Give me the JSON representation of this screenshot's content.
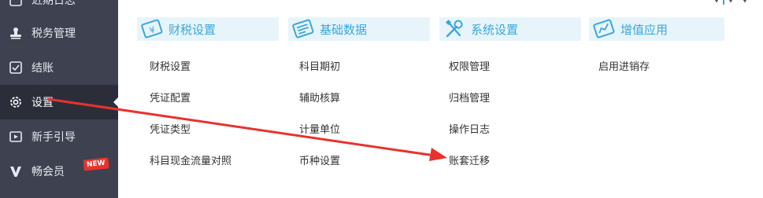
{
  "sidebar": {
    "items": [
      {
        "label": "近期日志",
        "icon": "calendar-icon"
      },
      {
        "label": "税务管理",
        "icon": "stamp-icon"
      },
      {
        "label": "结账",
        "icon": "checkout-icon"
      },
      {
        "label": "设置",
        "icon": "gear-icon"
      },
      {
        "label": "新手引导",
        "icon": "play-icon"
      },
      {
        "label": "畅会员",
        "icon": "vip-icon"
      }
    ],
    "new_badge": "NEW"
  },
  "menu": {
    "columns": [
      {
        "title": "财税设置",
        "icon": "tax-settings-icon",
        "items": [
          "财税设置",
          "凭证配置",
          "凭证类型",
          "科目现金流量对照"
        ]
      },
      {
        "title": "基础数据",
        "icon": "basic-data-icon",
        "items": [
          "科目期初",
          "辅助核算",
          "计量单位",
          "币种设置"
        ]
      },
      {
        "title": "系统设置",
        "icon": "tools-icon",
        "items": [
          "权限管理",
          "归档管理",
          "操作日志",
          "账套迁移"
        ]
      },
      {
        "title": "增值应用",
        "icon": "value-added-icon",
        "items": [
          "启用进销存"
        ]
      }
    ]
  },
  "colors": {
    "sidebar_bg": "#3d4150",
    "sidebar_active": "#2b2e39",
    "accent": "#3aa6dd",
    "header_bg": "#e7f5fb",
    "annotation_arrow": "#e8322e"
  }
}
